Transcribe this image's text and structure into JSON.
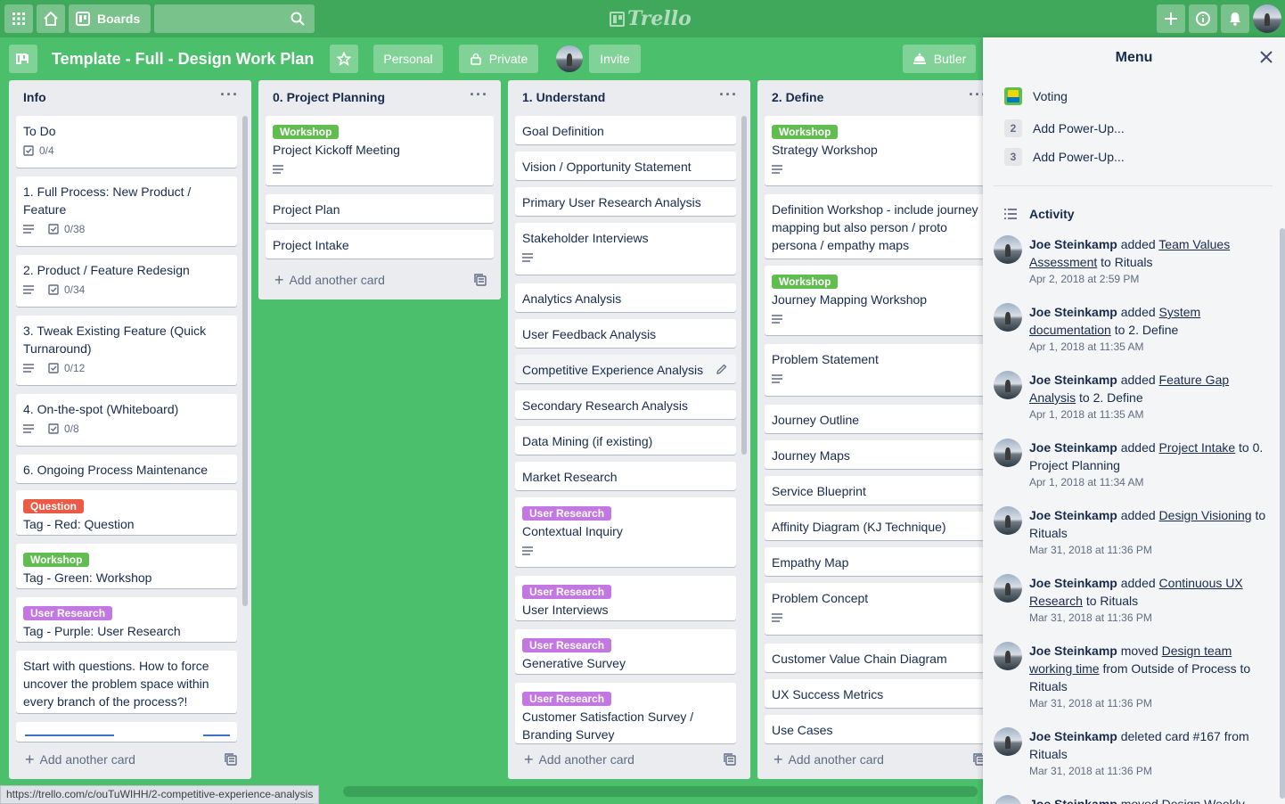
{
  "topbar": {
    "boards_label": "Boards",
    "logo_text": "Trello"
  },
  "board": {
    "title": "Template - Full - Design Work Plan",
    "personal_label": "Personal",
    "private_label": "Private",
    "invite_label": "Invite",
    "butler_label": "Butler"
  },
  "lists": [
    {
      "title": "Info",
      "add_label": "Add another card",
      "cards": [
        {
          "title": "To Do",
          "check": "0/4"
        },
        {
          "title": "1. Full Process: New Product / Feature",
          "check": "0/38"
        },
        {
          "title": "2. Product / Feature Redesign",
          "check": "0/34"
        },
        {
          "title": "3. Tweak Existing Feature (Quick Turnaround)",
          "check": "0/12"
        },
        {
          "title": "4. On-the-spot (Whiteboard)",
          "check": "0/8"
        },
        {
          "title": "6. Ongoing Process Maintenance"
        },
        {
          "title": "Tag - Red: Question",
          "label": "Question"
        },
        {
          "title": "Tag - Green: Workshop",
          "label": "Workshop"
        },
        {
          "title": "Tag - Purple: User Research",
          "label": "User Research"
        },
        {
          "title": "Start with questions. How to force uncover the problem space within every branch of the process?!"
        }
      ]
    },
    {
      "title": "0. Project Planning",
      "add_label": "Add another card",
      "cards": [
        {
          "title": "Project Kickoff Meeting",
          "label": "Workshop"
        },
        {
          "title": "Project Plan"
        },
        {
          "title": "Project Intake"
        }
      ]
    },
    {
      "title": "1. Understand",
      "add_label": "Add another card",
      "cards": [
        {
          "title": "Goal Definition"
        },
        {
          "title": "Vision / Opportunity Statement"
        },
        {
          "title": "Primary User Research Analysis"
        },
        {
          "title": "Stakeholder Interviews"
        },
        {
          "title": "Analytics Analysis"
        },
        {
          "title": "User Feedback Analysis"
        },
        {
          "title": "Competitive Experience Analysis"
        },
        {
          "title": "Secondary Research Analysis"
        },
        {
          "title": "Data Mining (if existing)"
        },
        {
          "title": "Market Research"
        },
        {
          "title": "Contextual Inquiry",
          "label": "User Research"
        },
        {
          "title": "User Interviews",
          "label": "User Research"
        },
        {
          "title": "Generative Survey",
          "label": "User Research"
        },
        {
          "title": "Customer Satisfaction Survey / Branding Survey",
          "label": "User Research"
        }
      ]
    },
    {
      "title": "2. Define",
      "add_label": "Add another card",
      "cards": [
        {
          "title": "Strategy Workshop",
          "label": "Workshop"
        },
        {
          "title": "Definition Workshop - include journey mapping but also person / proto persona / empathy maps"
        },
        {
          "title": "Journey Mapping Workshop",
          "label": "Workshop"
        },
        {
          "title": "Problem Statement"
        },
        {
          "title": "Journey Outline"
        },
        {
          "title": "Journey Maps"
        },
        {
          "title": "Service Blueprint"
        },
        {
          "title": "Affinity Diagram (KJ Technique)"
        },
        {
          "title": "Empathy Map"
        },
        {
          "title": "Problem Concept"
        },
        {
          "title": "Customer Value Chain Diagram"
        },
        {
          "title": "UX Success Metrics"
        },
        {
          "title": "Use Cases"
        }
      ]
    }
  ],
  "labels": {
    "colors": {
      "Workshop": "#61bd4f",
      "Question": "#eb5a46",
      "User Research": "#c377e0"
    }
  },
  "menu": {
    "title": "Menu",
    "powerups": [
      {
        "num": "",
        "label": "Voting"
      },
      {
        "num": "2",
        "label": "Add Power-Up..."
      },
      {
        "num": "3",
        "label": "Add Power-Up..."
      }
    ],
    "activity_title": "Activity",
    "activity": [
      {
        "user": "Joe Steinkamp",
        "verb": "added",
        "link": "Team Values Assessment",
        "prep": "to Rituals",
        "date": "Apr 2, 2018 at 2:59 PM"
      },
      {
        "user": "Joe Steinkamp",
        "verb": "added",
        "link": "System documentation",
        "prep": "to 2. Define",
        "date": "Apr 1, 2018 at 11:35 AM"
      },
      {
        "user": "Joe Steinkamp",
        "verb": "added",
        "link": "Feature Gap Analysis",
        "prep": "to 2. Define",
        "date": "Apr 1, 2018 at 11:35 AM"
      },
      {
        "user": "Joe Steinkamp",
        "verb": "added",
        "link": "Project Intake",
        "prep": "to 0. Project Planning",
        "date": "Apr 1, 2018 at 11:34 AM"
      },
      {
        "user": "Joe Steinkamp",
        "verb": "added",
        "link": "Design Visioning",
        "prep": "to Rituals",
        "date": "Mar 31, 2018 at 11:36 PM"
      },
      {
        "user": "Joe Steinkamp",
        "verb": "added",
        "link": "Continuous UX Research",
        "prep": "to Rituals",
        "date": "Mar 31, 2018 at 11:36 PM"
      },
      {
        "user": "Joe Steinkamp",
        "verb": "moved",
        "link": "Design team working time",
        "prep": "from Outside of Process to Rituals",
        "date": "Mar 31, 2018 at 11:36 PM"
      },
      {
        "user": "Joe Steinkamp",
        "verb": "deleted card #167 from",
        "link": "",
        "prep": "Rituals",
        "date": "Mar 31, 2018 at 11:36 PM"
      },
      {
        "user": "Joe Steinkamp",
        "verb": "moved",
        "link": "Design Weekly",
        "prep": "",
        "date": ""
      }
    ]
  },
  "status_url": "https://trello.com/c/ouTuWIHH/2-competitive-experience-analysis"
}
